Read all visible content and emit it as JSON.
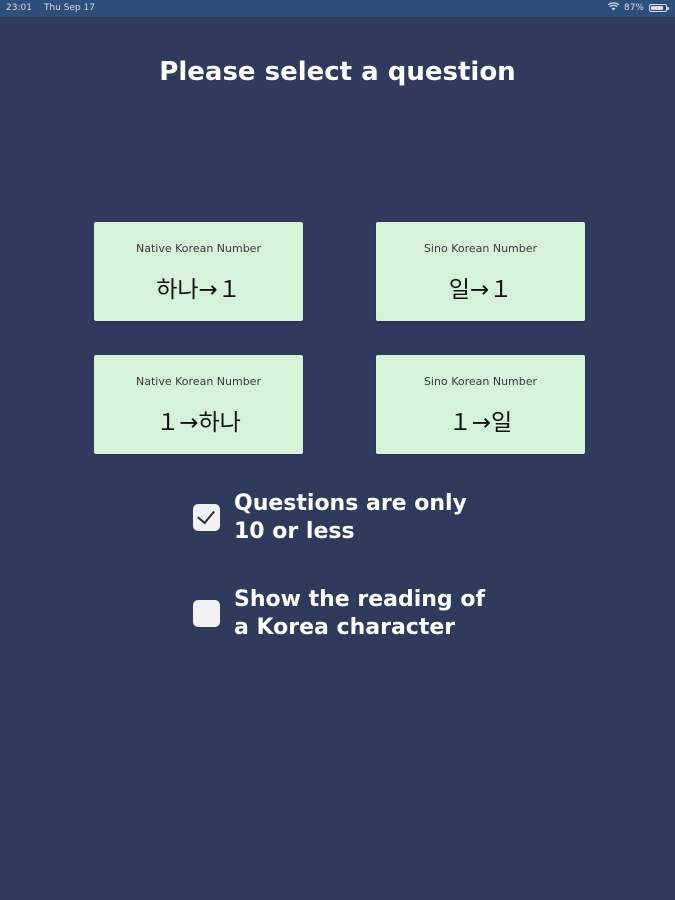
{
  "status_bar": {
    "time": "23:01",
    "date": "Thu Sep 17",
    "battery": "87%",
    "wifi_icon": "wifi-icon",
    "battery_icon": "battery-icon",
    "background_color": "#2e4f7c"
  },
  "page": {
    "title": "Please select a question",
    "background_color": "#2f3a5c",
    "card_color": "#d5f3d8"
  },
  "cards": [
    {
      "label": "Native Korean Number",
      "text": "하나→１"
    },
    {
      "label": "Sino Korean Number",
      "text": "일→１"
    },
    {
      "label": "Native Korean Number",
      "text": "１→하나"
    },
    {
      "label": "Sino Korean Number",
      "text": "１→일"
    }
  ],
  "options": [
    {
      "label_line1": "Questions are only",
      "label_line2": "10 or less",
      "checked": true
    },
    {
      "label_line1": "Show the reading of",
      "label_line2": "a Korea character",
      "checked": false
    }
  ]
}
